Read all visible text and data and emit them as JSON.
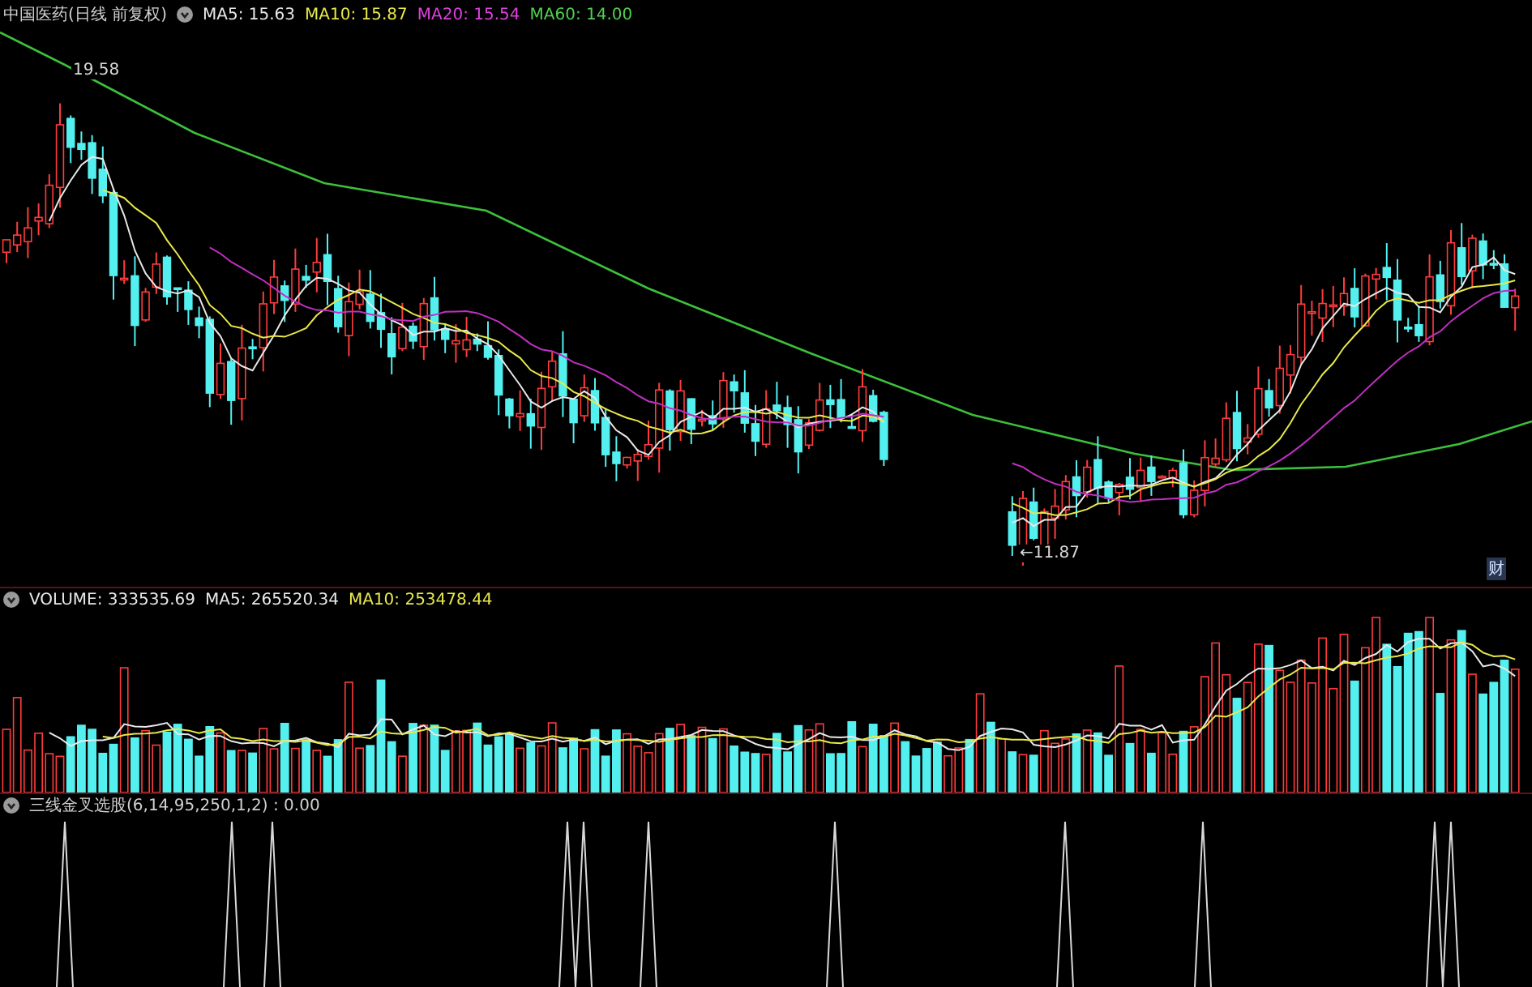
{
  "price_panel": {
    "title": "中国医药(日线 前复权)",
    "legend": [
      {
        "label": "MA5: 15.63",
        "color": "#e8e8e8"
      },
      {
        "label": "MA10: 15.87",
        "color": "#e8e84a"
      },
      {
        "label": "MA20: 15.54",
        "color": "#e040e0"
      },
      {
        "label": "MA60: 14.00",
        "color": "#50d050"
      }
    ],
    "high_label": "19.58",
    "low_label": "←11.87",
    "badge": "财"
  },
  "volume_panel": {
    "legend": [
      {
        "label": "VOLUME: 333535.69",
        "color": "#e8e8e8"
      },
      {
        "label": "MA5: 265520.34",
        "color": "#e8e8e8"
      },
      {
        "label": "MA10: 253478.44",
        "color": "#e8e84a"
      }
    ]
  },
  "indicator_panel": {
    "title": "三线金叉选股(6,14,95,250,1,2) : 0.00"
  }
}
